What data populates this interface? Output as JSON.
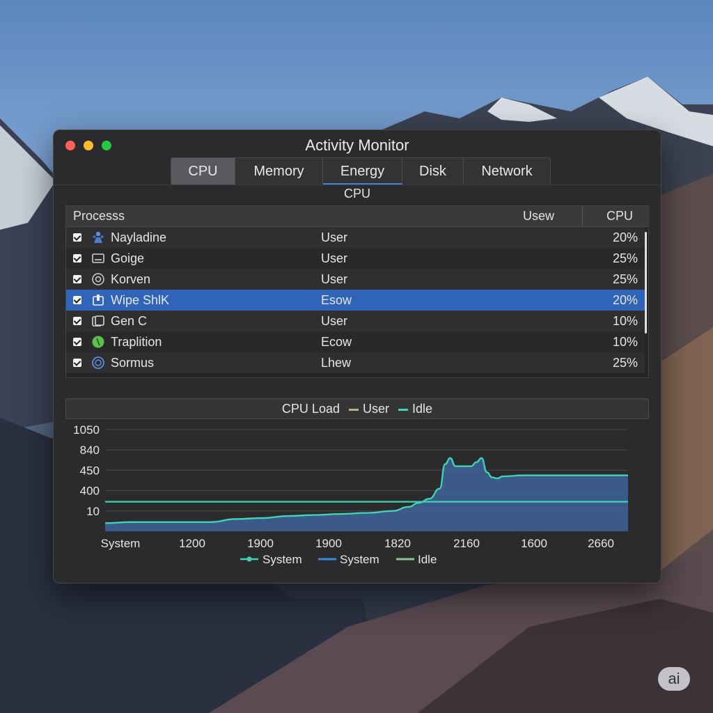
{
  "window": {
    "title": "Activity Monitor"
  },
  "tabs": [
    {
      "label": "CPU",
      "active": true
    },
    {
      "label": "Memory"
    },
    {
      "label": "Energy",
      "focused": true
    },
    {
      "label": "Disk"
    },
    {
      "label": "Network"
    }
  ],
  "section_title": "CPU",
  "table": {
    "columns": {
      "process": "Processs",
      "user": "Usew",
      "cpu": "CPU"
    },
    "rows": [
      {
        "name": "Nayladine",
        "user": "User",
        "cpu": "20%",
        "icon": "people-icon"
      },
      {
        "name": "Goige",
        "user": "User",
        "cpu": "25%",
        "icon": "window-icon"
      },
      {
        "name": "Korven",
        "user": "User",
        "cpu": "25%",
        "icon": "gear-icon"
      },
      {
        "name": "Wipe ShlK",
        "user": "Esow",
        "cpu": "20%",
        "icon": "app-icon",
        "selected": true
      },
      {
        "name": "Gen C",
        "user": "User",
        "cpu": "10%",
        "icon": "copy-icon"
      },
      {
        "name": "Traplition",
        "user": "Ecow",
        "cpu": "10%",
        "icon": "green-circle-icon"
      },
      {
        "name": "Sormus",
        "user": "Lhew",
        "cpu": "25%",
        "icon": "ring-icon"
      }
    ]
  },
  "colors": {
    "accent": "#2f64b8",
    "idle": "#3fd3b4",
    "user": "#b9b08a",
    "system_fill": "#3e5f94",
    "legend_system": "#3a8ad6",
    "legend_idle": "#8fc68f"
  },
  "chart_data": {
    "type": "area",
    "legend_top": [
      {
        "label": "CPU Load",
        "swatch": false
      },
      {
        "label": "User",
        "swatch": true,
        "color": "#b9b08a"
      },
      {
        "label": "Idle",
        "swatch": true,
        "color": "#3fd3b4"
      }
    ],
    "y_ticks": [
      "1050",
      "840",
      "450",
      "400",
      "10"
    ],
    "x_ticks": [
      "System",
      "1200",
      "1900",
      "1900",
      "1820",
      "2160",
      "1600",
      "2660"
    ],
    "ylim": [
      0,
      5
    ],
    "series": [
      {
        "name": "System",
        "kind": "area",
        "x": [
          0,
          0.05,
          0.1,
          0.2,
          0.25,
          0.3,
          0.35,
          0.4,
          0.45,
          0.5,
          0.55,
          0.58,
          0.6,
          0.62,
          0.64,
          0.65,
          0.66,
          0.67,
          0.7,
          0.71,
          0.72,
          0.73,
          0.74,
          0.75,
          0.76,
          0.8,
          0.85,
          0.9,
          0.95,
          1.0
        ],
        "values": [
          0.4,
          0.45,
          0.45,
          0.45,
          0.6,
          0.65,
          0.75,
          0.8,
          0.85,
          0.9,
          1.0,
          1.2,
          1.4,
          1.6,
          2.1,
          3.3,
          3.6,
          3.2,
          3.2,
          3.4,
          3.6,
          2.9,
          2.65,
          2.6,
          2.7,
          2.75,
          2.75,
          2.75,
          2.75,
          2.75
        ]
      },
      {
        "name": "Idle",
        "kind": "line",
        "x": [
          0,
          1.0
        ],
        "values": [
          1.45,
          1.45
        ]
      }
    ],
    "legend_bottom": [
      {
        "label": "System",
        "style": "dot-line",
        "color": "#3fd3b4"
      },
      {
        "label": "System",
        "style": "line",
        "color": "#3a8ad6"
      },
      {
        "label": "Idle",
        "style": "line",
        "color": "#8fc68f"
      }
    ]
  },
  "badge": "ai"
}
